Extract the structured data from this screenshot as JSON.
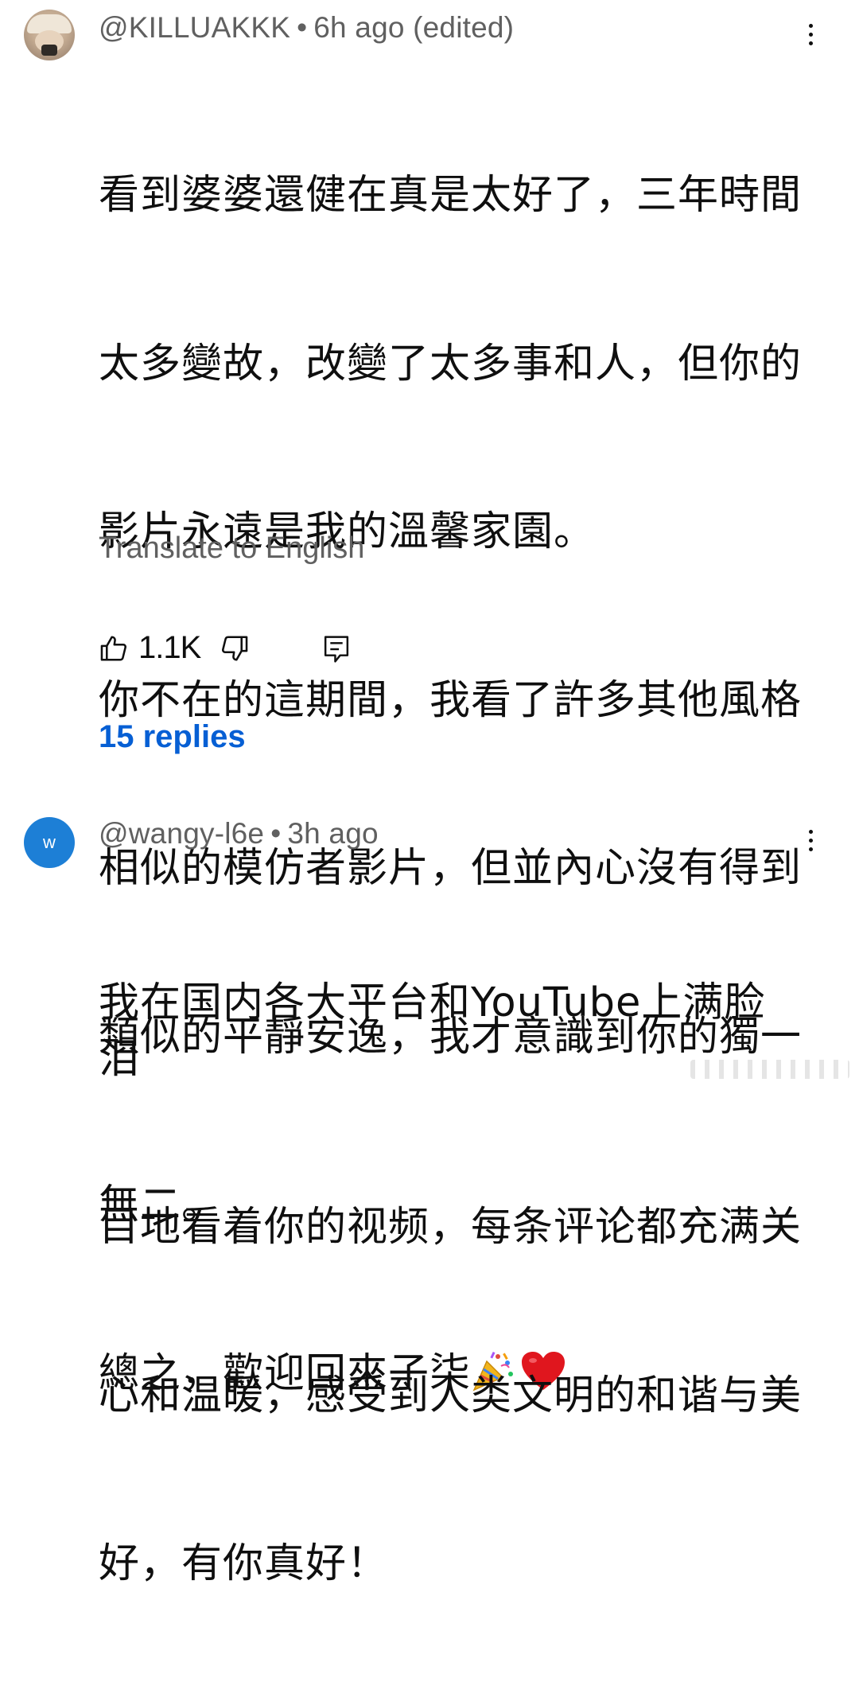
{
  "comments": [
    {
      "handle": "@KILLUAKKK",
      "separator": "•",
      "time": "6h ago (edited)",
      "avatar_icon": "user-photo-avatar",
      "lines": [
        "看到婆婆還健在真是太好了，三年時間",
        "太多變故，改變了太多事和人，但你的",
        "影片永遠是我的溫馨家園。",
        "你不在的這期間，我看了許多其他風格",
        "相似的模仿者影片，但並內心沒有得到",
        "類似的平靜安逸，我才意識到你的獨一",
        "無二。",
        "總之，歡迎回來子柒"
      ],
      "emojis": [
        "party-popper",
        "red-heart"
      ],
      "translate_label": "Translate to English",
      "like_count": "1.1K",
      "replies_label": "15 replies"
    },
    {
      "handle": "@wangy-l6e",
      "separator": "•",
      "time": "3h ago",
      "avatar_letter": "w",
      "lines": [
        "我在国内各大平台和YouTube上满脸泪",
        "目地看着你的视频，每条评论都充满关",
        "心和温暖，感受到人类文明的和谐与美",
        "好，有你真好！"
      ]
    }
  ],
  "colors": {
    "text": "#0f0f0f",
    "secondary": "#606060",
    "link": "#065fd4",
    "avatar_bg": "#1d7fd6"
  }
}
